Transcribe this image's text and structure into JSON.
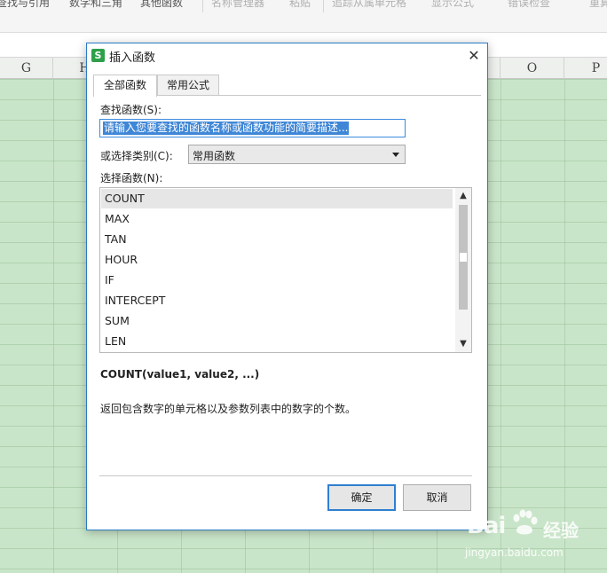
{
  "ribbon": {
    "items": [
      "查找与引用",
      "数学和三角",
      "其他函数",
      "名称管理器",
      "粘贴",
      "追踪从属单元格",
      "显示公式",
      "错误检查",
      "重算"
    ]
  },
  "columns": {
    "labels": [
      "G",
      "H",
      "O",
      "P"
    ]
  },
  "dialog": {
    "title": "插入函数",
    "close_label": "✕",
    "tabs": [
      {
        "label": "全部函数",
        "active": true
      },
      {
        "label": "常用公式",
        "active": false
      }
    ],
    "search_label": "查找函数(S):",
    "search_value": "请输入您要查找的函数名称或函数功能的简要描述...",
    "category_label": "或选择类别(C):",
    "category_value": "常用函数",
    "list_label": "选择函数(N):",
    "functions": [
      "COUNT",
      "MAX",
      "TAN",
      "HOUR",
      "IF",
      "INTERCEPT",
      "SUM",
      "LEN"
    ],
    "selected_function": "COUNT",
    "signature": "COUNT(value1, value2, ...)",
    "description": "返回包含数字的单元格以及参数列表中的数字的个数。",
    "ok_label": "确定",
    "cancel_label": "取消"
  },
  "watermark": {
    "logo": "Bai",
    "brand": "经验",
    "url": "jingyan.baidu.com"
  },
  "colors": {
    "accent": "#2b7bc4",
    "sheet_bg": "#c9e5c9",
    "app_icon": "#2ea04a"
  }
}
